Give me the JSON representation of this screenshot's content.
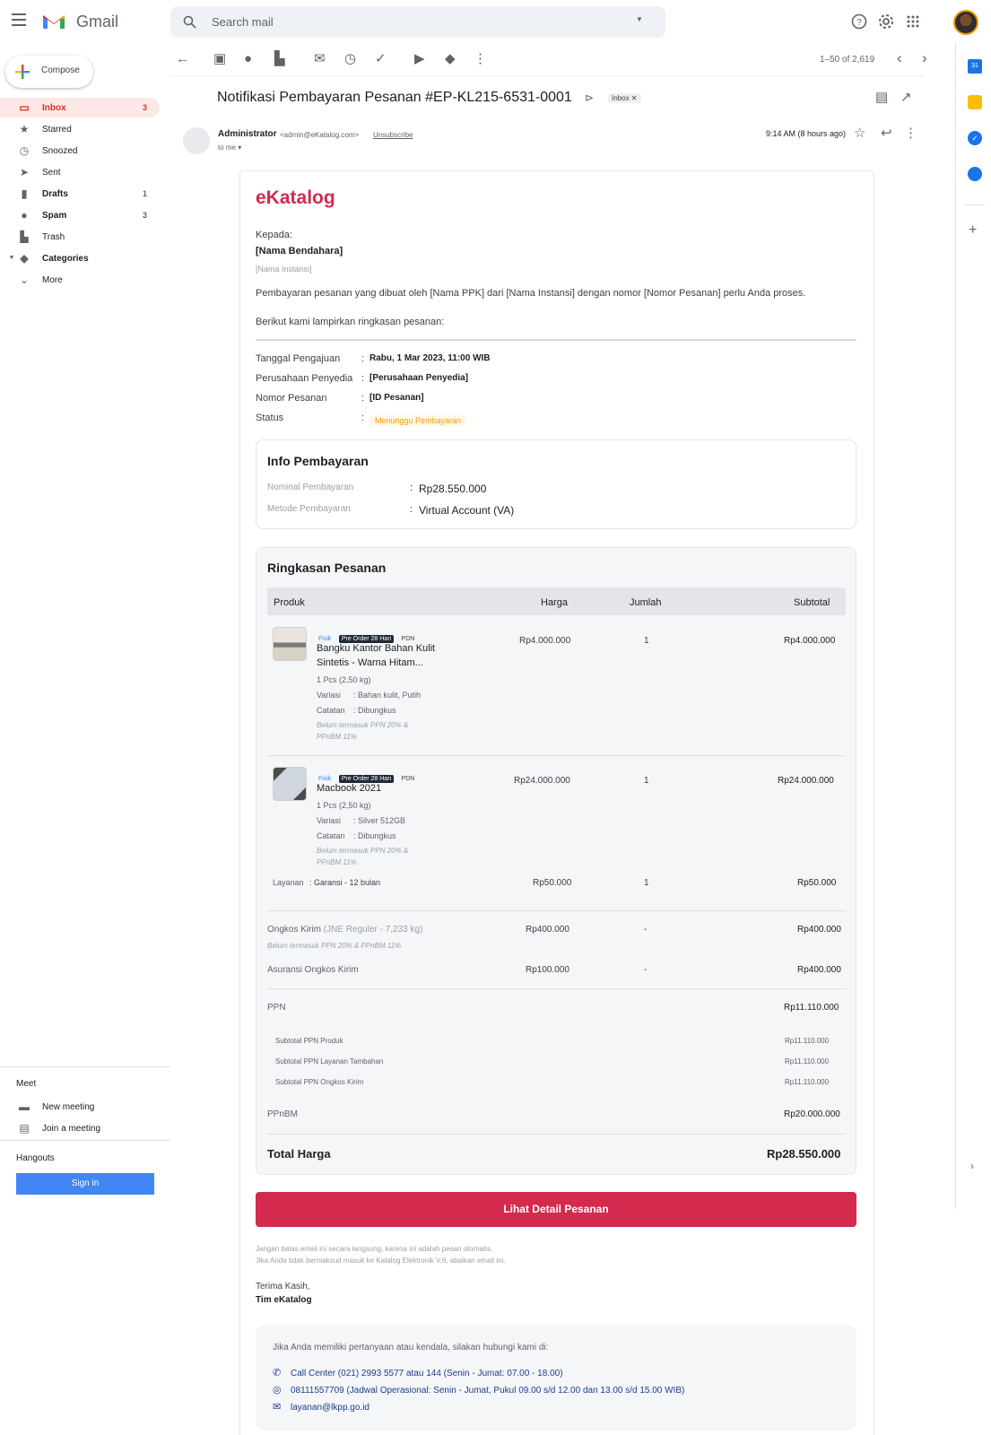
{
  "app": {
    "name": "Gmail"
  },
  "search": {
    "placeholder": "Search mail"
  },
  "compose_label": "Compose",
  "nav": [
    {
      "label": "Inbox",
      "count": "3",
      "icon": "inbox-icon"
    },
    {
      "label": "Starred",
      "count": "",
      "icon": "star-icon"
    },
    {
      "label": "Snoozed",
      "count": "",
      "icon": "clock-icon"
    },
    {
      "label": "Sent",
      "count": "",
      "icon": "send-icon"
    },
    {
      "label": "Drafts",
      "count": "1",
      "icon": "draft-icon"
    },
    {
      "label": "Spam",
      "count": "3",
      "icon": "spam-icon"
    },
    {
      "label": "Trash",
      "count": "",
      "icon": "trash-icon"
    },
    {
      "label": "Categories",
      "count": "",
      "icon": "chevron-down-icon"
    },
    {
      "label": "More",
      "count": "",
      "icon": "expand-icon"
    }
  ],
  "meet": {
    "title": "Meet",
    "new": "New meeting",
    "join": "Join a meeting"
  },
  "hangouts": {
    "title": "Hangouts",
    "signin": "Sign in"
  },
  "toolbar": {
    "pagination": "1–50 of 2,619"
  },
  "email": {
    "subject": "Notifikasi Pembayaran Pesanan #EP-KL215-6531-0001",
    "label_chip": "Inbox",
    "sender_name": "Administrator",
    "sender_email": "<admin@eKatalog.com>",
    "unsubscribe": "Unsubscribe",
    "to": "to me",
    "time": "9:14 AM (8 hours ago)"
  },
  "body": {
    "logo": "eKatalog",
    "kepada": "Kepada:",
    "nama_bendahara": "[Nama Bendahara]",
    "nama_instansi": "[Nama Instansi]",
    "intro": "Pembayaran pesanan yang dibuat oleh [Nama PPK] dari [Nama Instansi] dengan nomor [Nomor Pesanan] perlu Anda proses.",
    "lampiran": "Berikut kami lampirkan ringkasan pesanan:",
    "details": [
      {
        "label": "Tanggal Pengajuan",
        "value": "Rabu, 1 Mar 2023, 11:00 WIB"
      },
      {
        "label": "Perusahaan Penyedia",
        "value": "[Perusahaan Penyedia]"
      },
      {
        "label": "Nomor Pesanan",
        "value": "[ID Pesanan]"
      },
      {
        "label": "Status",
        "value": "Menunggu Pembayaran"
      }
    ],
    "info": {
      "title": "Info Pembayaran",
      "nominal_label": "Nominal Pembayaran",
      "nominal_value": "Rp28.550.000",
      "metode_label": "Metode Pembayaran",
      "metode_value": "Virtual Account (VA)"
    },
    "ringkasan": {
      "title": "Ringkasan Pesanan",
      "headers": {
        "produk": "Produk",
        "harga": "Harga",
        "jumlah": "Jumlah",
        "subtotal": "Subtotal"
      },
      "products": [
        {
          "fisik": "Fisik",
          "po": "Pre Order 28 Hari",
          "pdn": "PDN",
          "name1": "Bangku Kantor Bahan Kulit",
          "name2": "Sintetis - Warna Hitam...",
          "qty_weight": "1 Pcs (2,50 kg)",
          "variasi_label": "Variasi",
          "variasi": ": Bahan kulit, Putih",
          "catatan_label": "Catatan",
          "catatan": ": Dibungkus",
          "tax1": "Belum termasuk PPN 20% &",
          "tax2": "PPnBM 11%",
          "harga": "Rp4.000.000",
          "jumlah": "1",
          "subtotal": "Rp4.000.000"
        },
        {
          "fisik": "Fisik",
          "po": "Pre Order 28 Hari",
          "pdn": "PDN",
          "name1": "Macbook 2021",
          "name2": "",
          "qty_weight": "1 Pcs (2,50 kg)",
          "variasi_label": "Variasi",
          "variasi": ": Silver 512GB",
          "catatan_label": "Catatan",
          "catatan": ": Dibungkus",
          "tax1": "Belum termasuk PPN 20% &",
          "tax2": "PPnBM 11%",
          "harga": "Rp24.000.000",
          "jumlah": "1",
          "subtotal": "Rp24.000.000"
        }
      ],
      "layanan": {
        "label": "Layanan",
        "value": ": Garansi - 12 bulan",
        "harga": "Rp50.000",
        "jumlah": "1",
        "subtotal": "Rp50.000"
      },
      "ongkir": {
        "label": "Ongkos Kirim",
        "detail": "(JNE Reguler - 7,233 kg)",
        "note": "Belum termasuk PPN 20% & PPnBM 11%",
        "harga": "Rp400.000",
        "jumlah": "-",
        "subtotal": "Rp400.000"
      },
      "asuransi": {
        "label": "Asuransi Ongkos Kirim",
        "harga": "Rp100.000",
        "jumlah": "-",
        "subtotal": "Rp400.000"
      },
      "ppn": {
        "label": "PPN",
        "value": "Rp11.110.000"
      },
      "ppn_sub": [
        {
          "label": "Subtotal PPN Produk",
          "value": "Rp11.110.000"
        },
        {
          "label": "Subtotal PPN Layanan Tambahan",
          "value": "Rp11.110.000"
        },
        {
          "label": "Subtotal PPN Ongkos Kirim",
          "value": "Rp11.110.000"
        }
      ],
      "ppnbm": {
        "label": "PPnBM",
        "value": "Rp20.000.000"
      },
      "total": {
        "label": "Total Harga",
        "value": "Rp28.550.000"
      }
    },
    "button": "Lihat Detail Pesanan",
    "footer1": "Jangan balas email ini secara langsung, karena ini adalah pesan otomatis.",
    "footer2": "Jika Anda tidak bermaksud masuk ke Katalog Elektronik V.6, abaikan email ini.",
    "terima": "Terima Kasih,",
    "tim": "Tim eKatalog",
    "contact": {
      "intro": "Jika Anda memiliki pertanyaan atau kendala, silakan hubungi kami di:",
      "call": "Call Center (021) 2993 5577 atau 144 (Senin - Jumat: 07.00 - 18.00)",
      "wa": "08111557709 (Jadwal Operasional: Senin - Jumat, Pukul 09.00 s/d 12.00 dan  13.00 s/d 15.00 WIB)",
      "mail": "layanan@lkpp.go.id"
    }
  },
  "colors": {
    "brand": "#d32a4e",
    "gmail_red": "#d93025",
    "status_orange": "#f59e0b",
    "link_blue": "#1a3d8f"
  }
}
